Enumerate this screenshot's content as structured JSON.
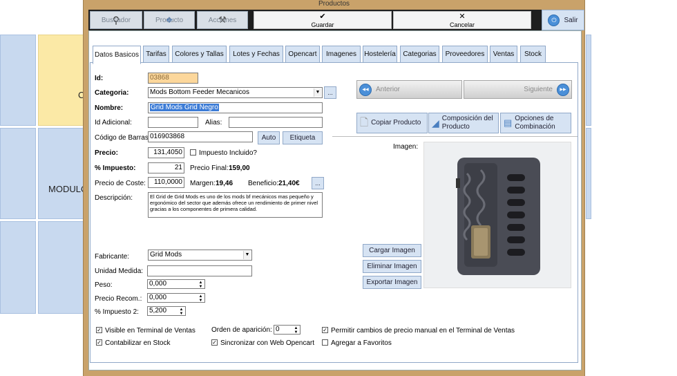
{
  "background": {
    "tile_label_1": "C",
    "tile_label_2": "MODULO"
  },
  "window": {
    "title": "Productos"
  },
  "toolbar": {
    "buscador": "Buscador",
    "producto": "Producto",
    "acciones": "Acciones",
    "guardar_glyph": "✔",
    "guardar": "Guardar",
    "cancelar_glyph": "✕",
    "cancelar": "Cancelar",
    "salir": "Salir"
  },
  "tabs": [
    "Datos Basicos",
    "Tarifas",
    "Colores y Tallas",
    "Lotes y Fechas",
    "Opencart",
    "Imagenes",
    "Hostelería",
    "Categorias",
    "Proveedores",
    "Ventas",
    "Stock"
  ],
  "form": {
    "id_label": "Id:",
    "id_value": "03868",
    "categoria_label": "Categoria:",
    "categoria_value": "Mods Bottom Feeder Mecanicos",
    "ellipsis": "...",
    "nombre_label": "Nombre:",
    "nombre_value": "Grid Mods Grid Negro",
    "id_adicional_label": "Id Adicional:",
    "id_adicional_value": "",
    "alias_label": "Alias:",
    "alias_value": "",
    "codigo_label": "Código de Barras:",
    "codigo_value": "016903868",
    "auto_button": "Auto",
    "etiqueta_button": "Etiqueta",
    "precio_label": "Precio:",
    "precio_value": "131,4050",
    "impuesto_incluido_label": "Impuesto Incluido?",
    "impuesto_label": "% Impuesto:",
    "impuesto_value": "21",
    "precio_final_label": "Precio Final:",
    "precio_final_value": "159,00",
    "coste_label": "Precio de Coste:",
    "coste_value": "110,0000",
    "margen_label": "Margen:",
    "margen_value": "19,46",
    "beneficio_label": "Beneficio:",
    "beneficio_value": "21,40€",
    "descripcion_label": "Descripción:",
    "descripcion_value": "El Grid de Grid Mods es uno de los mods bf mecánicos mas pequeño y ergonómico del sector que además ofrece un rendimiento de primer nivel gracias a los componentes de primera calidad.",
    "fabricante_label": "Fabricante:",
    "fabricante_value": "Grid Mods",
    "unidad_label": "Unidad Medida:",
    "unidad_value": "",
    "peso_label": "Peso:",
    "peso_value": "0,000",
    "recom_label": "Precio Recom.:",
    "recom_value": "0,000",
    "impuesto2_label": "% Impuesto 2:",
    "impuesto2_value": "5,200",
    "visible_label": "Visible en Terminal de Ventas",
    "contabilizar_label": "Contabilizar en Stock",
    "orden_label": "Orden de aparición:",
    "orden_value": "0",
    "sincronizar_label": "Sincronizar con Web Opencart",
    "permitir_label": "Permitir cambios de precio manual en el Terminal de Ventas",
    "favoritos_label": "Agregar a Favoritos",
    "check_mark": "✓"
  },
  "nav": {
    "anterior": "Anterior",
    "siguiente": "Siguiente",
    "prev_glyph": "◀◀",
    "next_glyph": "▶▶"
  },
  "actions": {
    "copiar": "Copiar Producto",
    "composicion": "Composición del Producto",
    "opciones": "Opciones de Combinación"
  },
  "image_panel": {
    "label": "Imagen:",
    "cargar": "Cargar Imagen",
    "eliminar": "Eliminar Imagen",
    "exportar": "Exportar Imagen"
  },
  "colors": {
    "accent": "#d6e3f3",
    "window_frame": "#c9a26a",
    "id_field": "#fcd79b",
    "selection": "#3b7bd6"
  }
}
